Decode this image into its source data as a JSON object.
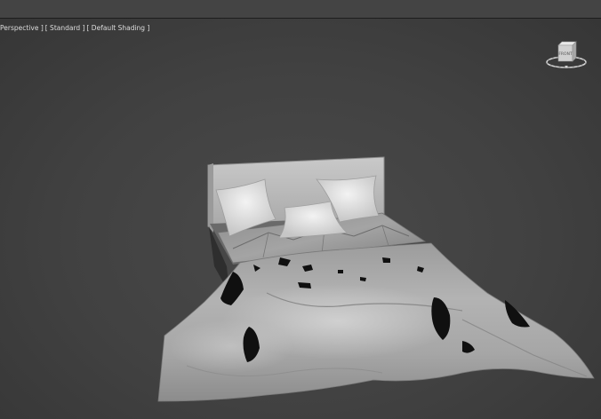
{
  "viewport": {
    "label_view": "Perspective ]",
    "label_mode": "[ Standard ]",
    "label_shading": "[ Default Shading ]",
    "viewcube_face": "FRONT"
  },
  "scene": {
    "object": "bed-model"
  },
  "colors": {
    "viewport_bg": "#414141",
    "topbar": "#444444",
    "mesh": "#bdbdbd",
    "mesh_shadow": "#707070"
  }
}
